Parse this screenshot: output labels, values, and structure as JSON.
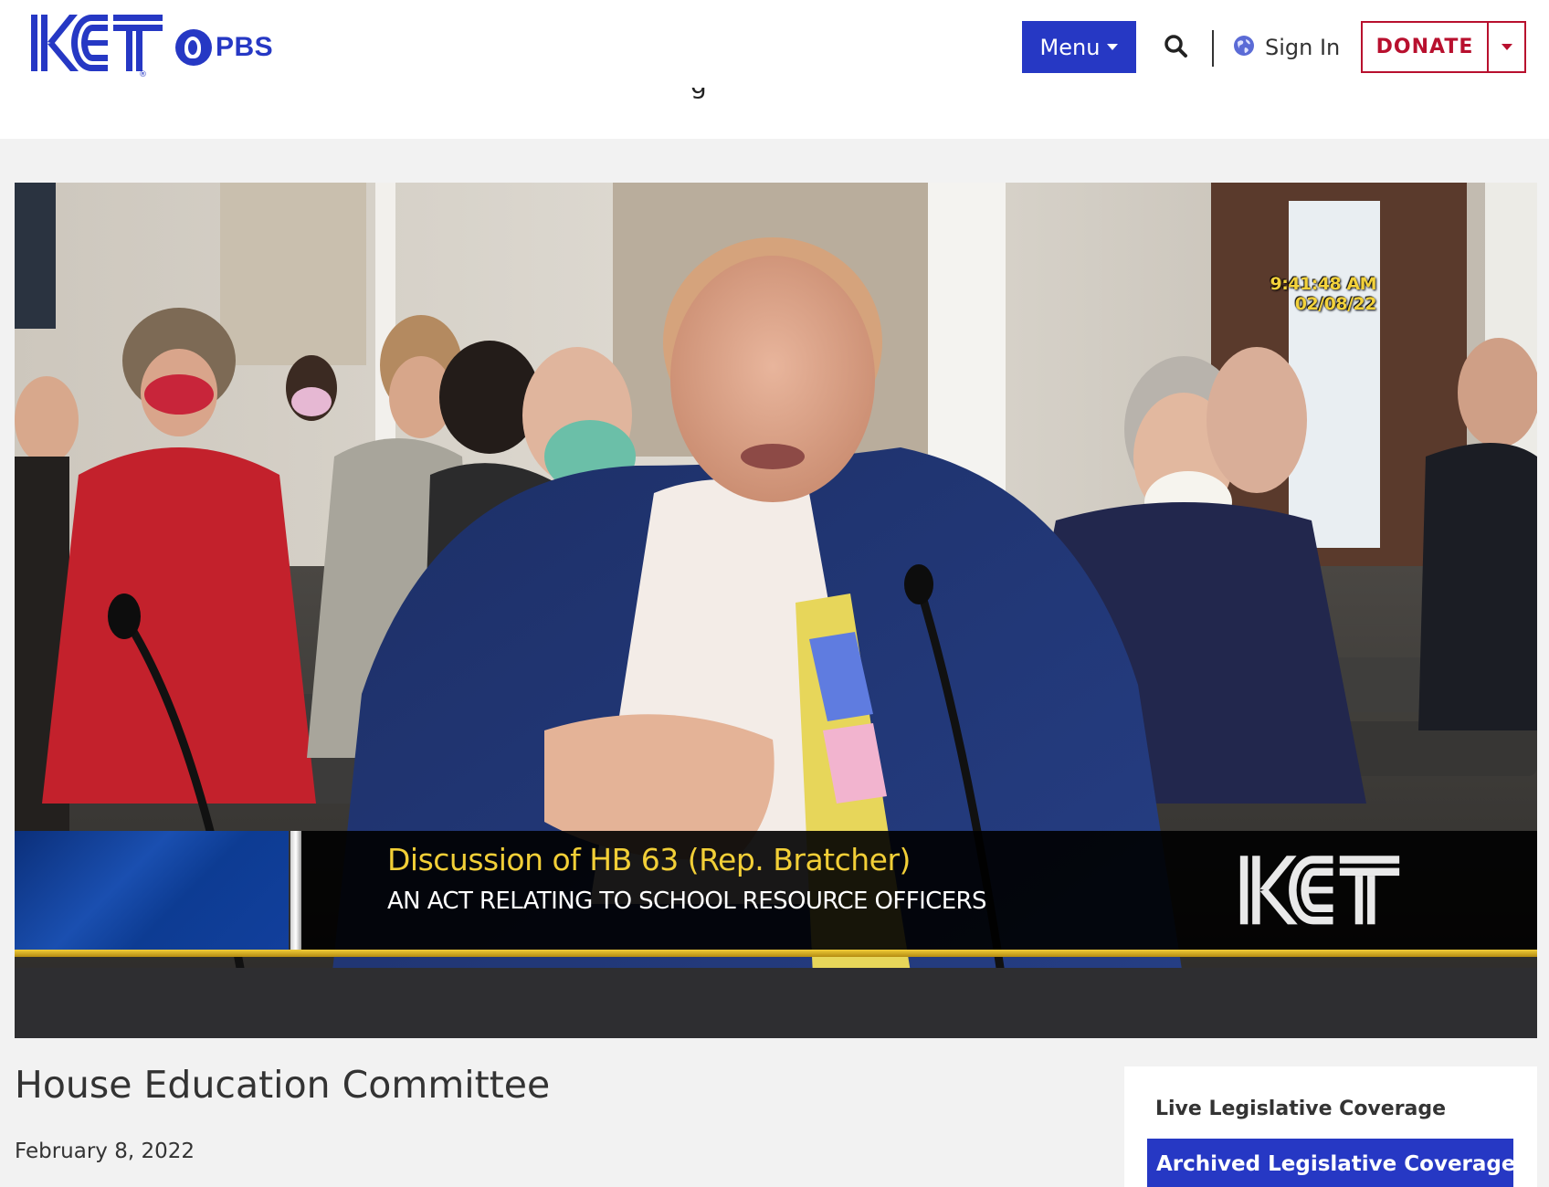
{
  "header": {
    "logo_text": "KET",
    "pbs_label": "PBS",
    "menu_label": "Menu",
    "signin_label": "Sign In",
    "donate_label": "DONATE",
    "fragment_char": "g"
  },
  "colors": {
    "brand_blue": "#2638c4",
    "donate_red": "#b8102e",
    "caption_gold": "#f2cf37"
  },
  "icons": {
    "search": "search-icon",
    "globe": "globe-icon",
    "caret": "chevron-down-icon"
  },
  "video": {
    "timestamp_time": "9:41:48 AM",
    "timestamp_date": "02/08/22",
    "caption_title": "Discussion of HB 63 (Rep. Bratcher)",
    "caption_subtitle": "AN ACT RELATING TO SCHOOL RESOURCE OFFICERS",
    "watermark_text": "KET"
  },
  "main": {
    "title": "House Education Committee",
    "date": "February 8, 2022"
  },
  "sidebar": {
    "items": [
      {
        "label": "Live Legislative Coverage",
        "active": false
      },
      {
        "label": "Archived Legislative Coverage",
        "active": true
      }
    ]
  }
}
